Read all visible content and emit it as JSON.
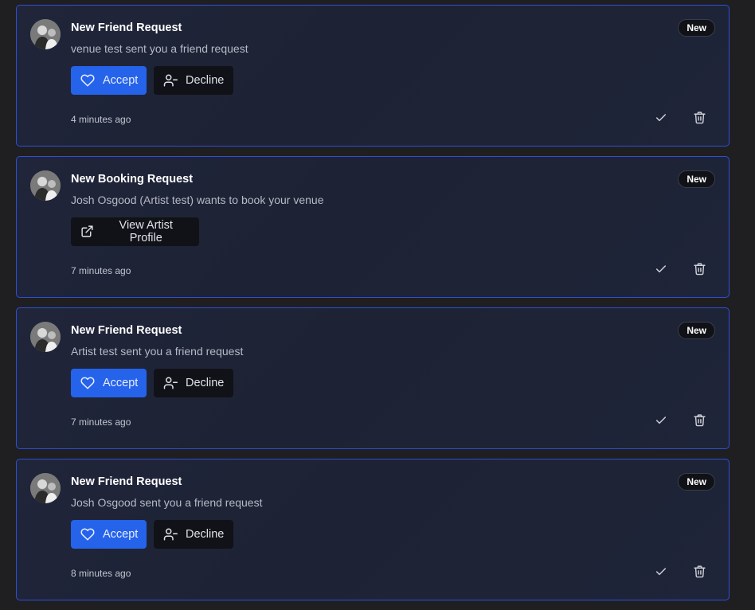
{
  "notifications": [
    {
      "title": "New Friend Request",
      "message": "venue test sent you a friend request",
      "badge": "New",
      "time": "4 minutes ago",
      "type": "friend",
      "accept_label": "Accept",
      "decline_label": "Decline"
    },
    {
      "title": "New Booking Request",
      "message": "Josh Osgood (Artist test) wants to book your venue",
      "badge": "New",
      "time": "7 minutes ago",
      "type": "booking",
      "view_label": "View Artist Profile"
    },
    {
      "title": "New Friend Request",
      "message": "Artist test sent you a friend request",
      "badge": "New",
      "time": "7 minutes ago",
      "type": "friend",
      "accept_label": "Accept",
      "decline_label": "Decline"
    },
    {
      "title": "New Friend Request",
      "message": "Josh Osgood sent you a friend request",
      "badge": "New",
      "time": "8 minutes ago",
      "type": "friend",
      "accept_label": "Accept",
      "decline_label": "Decline"
    }
  ],
  "icons": {
    "accept": "heart-icon",
    "decline": "user-minus-icon",
    "view": "external-link-icon",
    "mark_read": "check-icon",
    "delete": "trash-icon"
  },
  "colors": {
    "accent": "#2563eb",
    "card_border": "#2d4fd6",
    "card_bg": "#1f2538",
    "page_bg": "#1f1f22"
  }
}
